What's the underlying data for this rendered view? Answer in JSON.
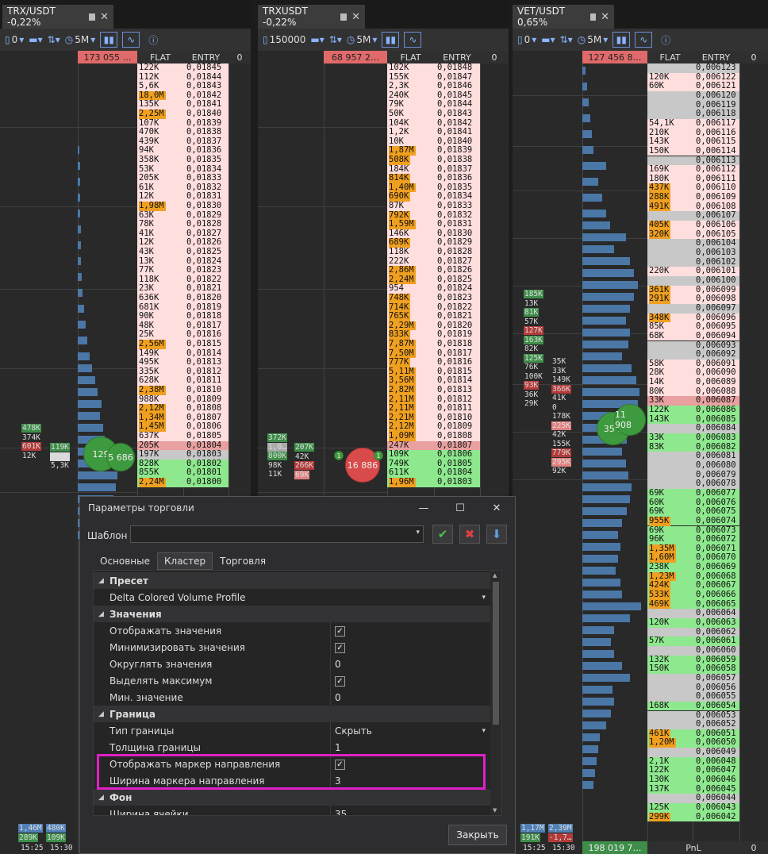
{
  "panels": [
    {
      "id": "p1",
      "tab_title": "TRX/USDT -0,22%",
      "volume_setting": "0",
      "timeframe": "5M",
      "header_total": "173 055 …",
      "col_flat": "FLAT",
      "col_entry": "ENTRY",
      "col_zero": "0",
      "rows": [
        [
          "122K",
          "0,01845"
        ],
        [
          "112K",
          "0,01844"
        ],
        [
          "5,6K",
          "0,01843"
        ],
        [
          "18,0M",
          "0,01842"
        ],
        [
          "135K",
          "0,01841"
        ],
        [
          "2,25M",
          "0,01840"
        ],
        [
          "107K",
          "0,01839"
        ],
        [
          "470K",
          "0,01838"
        ],
        [
          "439K",
          "0,01837"
        ],
        [
          "94K",
          "0,01836"
        ],
        [
          "358K",
          "0,01835"
        ],
        [
          "53K",
          "0,01834"
        ],
        [
          "205K",
          "0,01833"
        ],
        [
          "61K",
          "0,01832"
        ],
        [
          "12K",
          "0,01831"
        ],
        [
          "1,98M",
          "0,01830"
        ],
        [
          "63K",
          "0,01829"
        ],
        [
          "78K",
          "0,01828"
        ],
        [
          "41K",
          "0,01827"
        ],
        [
          "12K",
          "0,01826"
        ],
        [
          "43K",
          "0,01825"
        ],
        [
          "13K",
          "0,01824"
        ],
        [
          "77K",
          "0,01823"
        ],
        [
          "118K",
          "0,01822"
        ],
        [
          "23K",
          "0,01821"
        ],
        [
          "636K",
          "0,01820"
        ],
        [
          "681K",
          "0,01819"
        ],
        [
          "90K",
          "0,01818"
        ],
        [
          "48K",
          "0,01817"
        ],
        [
          "25K",
          "0,01816"
        ],
        [
          "2,56M",
          "0,01815"
        ],
        [
          "149K",
          "0,01814"
        ],
        [
          "495K",
          "0,01813"
        ],
        [
          "335K",
          "0,01812"
        ],
        [
          "628K",
          "0,01811"
        ],
        [
          "2,38M",
          "0,01810"
        ],
        [
          "988K",
          "0,01809"
        ],
        [
          "2,12M",
          "0,01808"
        ],
        [
          "1,34M",
          "0,01807"
        ],
        [
          "1,45M",
          "0,01806"
        ],
        [
          "637K",
          "0,01805"
        ],
        [
          "205K",
          "0,01804"
        ],
        [
          "197K",
          "0,01803"
        ],
        [
          "828K",
          "0,01802"
        ],
        [
          "855K",
          "0,01801"
        ],
        [
          "2,24M",
          "0,01800"
        ]
      ],
      "bubble1": "129",
      "bubble2": "5 686",
      "mini_left": [
        "478K",
        "374K",
        "601K",
        "12K"
      ],
      "mini_right": [
        "119K",
        "356K",
        "5,3K"
      ],
      "footer_left": [
        "1,46M",
        "289K"
      ],
      "footer_right": [
        "480K",
        "109K"
      ],
      "time1": "15:25",
      "time2": "15:30"
    },
    {
      "id": "p2",
      "tab_title": "TRXUSDT -0,22%",
      "volume_setting": "150000",
      "timeframe": "5M",
      "header_total": "68 957 2…",
      "col_flat": "FLAT",
      "col_entry": "ENTRY",
      "col_zero": "0",
      "rows": [
        [
          "102K",
          "0,01848"
        ],
        [
          "155K",
          "0,01847"
        ],
        [
          "2,3K",
          "0,01846"
        ],
        [
          "240K",
          "0,01845"
        ],
        [
          "79K",
          "0,01844"
        ],
        [
          "50K",
          "0,01843"
        ],
        [
          "104K",
          "0,01842"
        ],
        [
          "1,2K",
          "0,01841"
        ],
        [
          "10K",
          "0,01840"
        ],
        [
          "1,87M",
          "0,01839"
        ],
        [
          "508K",
          "0,01838"
        ],
        [
          "184K",
          "0,01837"
        ],
        [
          "814K",
          "0,01836"
        ],
        [
          "1,40M",
          "0,01835"
        ],
        [
          "690K",
          "0,01834"
        ],
        [
          "87K",
          "0,01833"
        ],
        [
          "792K",
          "0,01832"
        ],
        [
          "1,59M",
          "0,01831"
        ],
        [
          "146K",
          "0,01830"
        ],
        [
          "689K",
          "0,01829"
        ],
        [
          "118K",
          "0,01828"
        ],
        [
          "222K",
          "0,01827"
        ],
        [
          "2,86M",
          "0,01826"
        ],
        [
          "2,24M",
          "0,01825"
        ],
        [
          "954",
          "0,01824"
        ],
        [
          "748K",
          "0,01823"
        ],
        [
          "714K",
          "0,01822"
        ],
        [
          "765K",
          "0,01821"
        ],
        [
          "2,29M",
          "0,01820"
        ],
        [
          "833K",
          "0,01819"
        ],
        [
          "7,87M",
          "0,01818"
        ],
        [
          "7,50M",
          "0,01817"
        ],
        [
          "777K",
          "0,01816"
        ],
        [
          "5,11M",
          "0,01815"
        ],
        [
          "3,56M",
          "0,01814"
        ],
        [
          "2,82M",
          "0,01813"
        ],
        [
          "2,11M",
          "0,01812"
        ],
        [
          "2,11M",
          "0,01811"
        ],
        [
          "2,21M",
          "0,01810"
        ],
        [
          "2,12M",
          "0,01809"
        ],
        [
          "1,09M",
          "0,01808"
        ],
        [
          "247K",
          "0,01807"
        ],
        [
          "109K",
          "0,01806"
        ],
        [
          "749K",
          "0,01805"
        ],
        [
          "611K",
          "0,01804"
        ],
        [
          "1,96M",
          "0,01803"
        ]
      ],
      "bubble1": "16 886",
      "mini_left": [
        "372K",
        "1,0…",
        "800K",
        "98K",
        "11K"
      ],
      "mini_right": [
        "207K",
        "42K",
        "266K",
        "69K"
      ],
      "badge": "1"
    },
    {
      "id": "p3",
      "tab_title": "VET/USDT 0,65%",
      "volume_setting": "0",
      "timeframe": "5M",
      "header_total": "127 456 8…",
      "col_flat": "FLAT",
      "col_entry": "ENTRY",
      "col_zero": "0",
      "rows": [
        [
          "",
          "0,006123"
        ],
        [
          "120K",
          "0,006122"
        ],
        [
          "60K",
          "0,006121"
        ],
        [
          "",
          "0,006120"
        ],
        [
          "",
          "0,006119"
        ],
        [
          "",
          "0,006118"
        ],
        [
          "54,1K",
          "0,006117"
        ],
        [
          "210K",
          "0,006116"
        ],
        [
          "143K",
          "0,006115"
        ],
        [
          "150K",
          "0,006114"
        ],
        [
          "",
          "0,006113"
        ],
        [
          "169K",
          "0,006112"
        ],
        [
          "180K",
          "0,006111"
        ],
        [
          "437K",
          "0,006110"
        ],
        [
          "288K",
          "0,006109"
        ],
        [
          "491K",
          "0,006108"
        ],
        [
          "",
          "0,006107"
        ],
        [
          "405K",
          "0,006106"
        ],
        [
          "320K",
          "0,006105"
        ],
        [
          "",
          "0,006104"
        ],
        [
          "",
          "0,006103"
        ],
        [
          "",
          "0,006102"
        ],
        [
          "220K",
          "0,006101"
        ],
        [
          "",
          "0,006100"
        ],
        [
          "361K",
          "0,006099"
        ],
        [
          "291K",
          "0,006098"
        ],
        [
          "",
          "0,006097"
        ],
        [
          "348K",
          "0,006096"
        ],
        [
          "85K",
          "0,006095"
        ],
        [
          "68K",
          "0,006094"
        ],
        [
          "",
          "0,006093"
        ],
        [
          "",
          "0,006092"
        ],
        [
          "58K",
          "0,006091"
        ],
        [
          "28K",
          "0,006090"
        ],
        [
          "14K",
          "0,006089"
        ],
        [
          "80K",
          "0,006088"
        ],
        [
          "33K",
          "0,006087"
        ],
        [
          "122K",
          "0,006086"
        ],
        [
          "143K",
          "0,006085"
        ],
        [
          "",
          "0,006084"
        ],
        [
          "33K",
          "0,006083"
        ],
        [
          "83K",
          "0,006082"
        ],
        [
          "",
          "0,006081"
        ],
        [
          "",
          "0,006080"
        ],
        [
          "",
          "0,006079"
        ],
        [
          "",
          "0,006078"
        ],
        [
          "69K",
          "0,006077"
        ],
        [
          "60K",
          "0,006076"
        ],
        [
          "69K",
          "0,006075"
        ],
        [
          "955K",
          "0,006074"
        ],
        [
          "69K",
          "0,006073"
        ],
        [
          "96K",
          "0,006072"
        ],
        [
          "1,35M",
          "0,006071"
        ],
        [
          "1,60M",
          "0,006070"
        ],
        [
          "238K",
          "0,006069"
        ],
        [
          "1,23M",
          "0,006068"
        ],
        [
          "424K",
          "0,006067"
        ],
        [
          "533K",
          "0,006066"
        ],
        [
          "469K",
          "0,006065"
        ],
        [
          "",
          "0,006064"
        ],
        [
          "120K",
          "0,006063"
        ],
        [
          "",
          "0,006062"
        ],
        [
          "57K",
          "0,006061"
        ],
        [
          "",
          "0,006060"
        ],
        [
          "132K",
          "0,006059"
        ],
        [
          "150K",
          "0,006058"
        ],
        [
          "",
          "0,006057"
        ],
        [
          "",
          "0,006056"
        ],
        [
          "",
          "0,006055"
        ],
        [
          "168K",
          "0,006054"
        ],
        [
          "",
          "0,006053"
        ],
        [
          "",
          "0,006052"
        ],
        [
          "461K",
          "0,006051"
        ],
        [
          "1,20M",
          "0,006050"
        ],
        [
          "",
          "0,006049"
        ],
        [
          "2,1K",
          "0,006048"
        ],
        [
          "122K",
          "0,006047"
        ],
        [
          "130K",
          "0,006046"
        ],
        [
          "137K",
          "0,006045"
        ],
        [
          "",
          "0,006044"
        ],
        [
          "125K",
          "0,006043"
        ],
        [
          "299K",
          "0,006042"
        ]
      ],
      "bubble1": "35 1",
      "bubble2": "11 908",
      "mini_left": [
        "185K",
        "13K",
        "81K",
        "57K",
        "127K",
        "163K",
        "82K",
        "125K",
        "76K",
        "100K",
        "93K",
        "36K",
        "29K"
      ],
      "mini_right": [
        "35K",
        "33K",
        "149K",
        "366K",
        "41K",
        "0",
        "178K",
        "225K",
        "42K",
        "155K",
        "779K",
        "295K",
        "92K"
      ],
      "footer_left": [
        "1,17M",
        "191K"
      ],
      "footer_right": [
        "2,39M",
        "-1,7…"
      ],
      "footer_total": "198 019 7…",
      "footer_pnl": "PnL",
      "footer_zero": "0",
      "time1": "15:25",
      "time2": "15:30"
    }
  ],
  "dialog": {
    "title": "Параметры торговли",
    "template_label": "Шаблон",
    "template_value": "",
    "tabs": [
      "Основные",
      "Кластер",
      "Торговля"
    ],
    "rows": [
      {
        "type": "section",
        "label": "Пресет"
      },
      {
        "type": "item",
        "label": "Delta Colored Volume Profile",
        "value": "",
        "dropdown": true,
        "full": true
      },
      {
        "type": "section",
        "label": "Значения"
      },
      {
        "type": "item",
        "label": "Отображать значения",
        "check": true
      },
      {
        "type": "item",
        "label": "Минимизировать значения",
        "check": true
      },
      {
        "type": "item",
        "label": "Округлять значения",
        "value": "0"
      },
      {
        "type": "item",
        "label": "Выделять максимум",
        "check": true
      },
      {
        "type": "item",
        "label": "Мин. значение",
        "value": "0"
      },
      {
        "type": "section",
        "label": "Граница"
      },
      {
        "type": "item",
        "label": "Тип границы",
        "value": "Скрыть",
        "dropdown": true
      },
      {
        "type": "item",
        "label": "Толщина границы",
        "value": "1"
      },
      {
        "type": "item",
        "label": "Отображать маркер направления",
        "check": true
      },
      {
        "type": "item",
        "label": "Ширина маркера направления",
        "value": "3"
      },
      {
        "type": "section",
        "label": "Фон"
      },
      {
        "type": "item",
        "label": "Ширина ячейки",
        "value": "35"
      }
    ],
    "close_label": "Закрыть",
    "highlight_color": "#e01fc6"
  },
  "colors": {
    "pink": "#ffdede",
    "orange": "#f0a020",
    "green": "#8ee88e",
    "bar_blue": "#4f7fb5",
    "grey_row": "#c8c8c8"
  }
}
